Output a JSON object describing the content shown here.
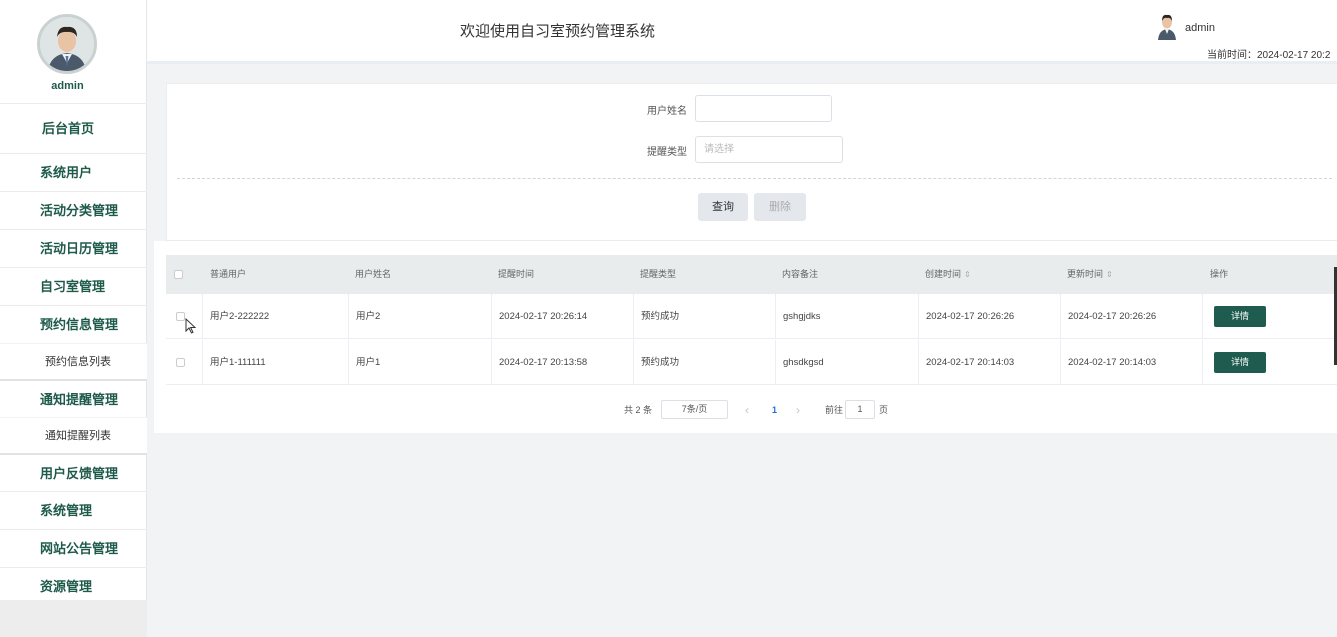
{
  "sidebar": {
    "username": "admin",
    "menu": [
      {
        "label": "后台首页"
      },
      {
        "label": "系统用户"
      },
      {
        "label": "活动分类管理"
      },
      {
        "label": "活动日历管理"
      },
      {
        "label": "自习室管理"
      },
      {
        "label": "预约信息管理"
      },
      {
        "label": "预约信息列表"
      },
      {
        "label": "通知提醒管理"
      },
      {
        "label": "通知提醒列表"
      },
      {
        "label": "用户反馈管理"
      },
      {
        "label": "系统管理"
      },
      {
        "label": "网站公告管理"
      },
      {
        "label": "资源管理"
      }
    ]
  },
  "header": {
    "title": "欢迎使用自习室预约管理系统",
    "user": "admin",
    "time": "当前时间：2024-02-17 20:2"
  },
  "search": {
    "name_label": "用户姓名",
    "name_value": "",
    "type_label": "提醒类型",
    "type_placeholder": "请选择",
    "query_button": "查询",
    "delete_button": "删除"
  },
  "table": {
    "headers": [
      "普通用户",
      "用户姓名",
      "提醒时间",
      "提醒类型",
      "内容备注",
      "创建时间",
      "更新时间",
      "操作"
    ],
    "rows": [
      [
        "用户2-222222",
        "用户2",
        "2024-02-17 20:26:14",
        "预约成功",
        "gshgjdks",
        "2024-02-17 20:26:26",
        "2024-02-17 20:26:26",
        "详情"
      ],
      [
        "用户1-111111",
        "用户1",
        "2024-02-17 20:13:58",
        "预约成功",
        "ghsdkgsd",
        "2024-02-17 20:14:03",
        "2024-02-17 20:14:03",
        "详情"
      ]
    ]
  },
  "pagination": {
    "total": "共 2 条",
    "page_size": "7条/页",
    "prev": "‹",
    "current_page": "1",
    "next": "›",
    "goto_label": "前往",
    "goto_value": "1",
    "page_suffix": "页"
  },
  "colors": {
    "accent": "#1f5c4f",
    "menu_text": "#1e5a4a"
  }
}
